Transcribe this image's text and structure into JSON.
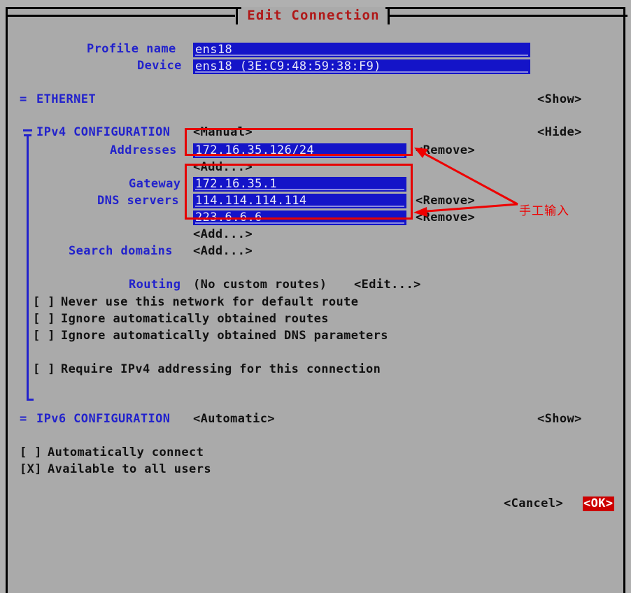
{
  "window": {
    "title": "Edit Connection"
  },
  "form": {
    "profile_name_label": "Profile name",
    "profile_name_value": "ens18",
    "device_label": "Device",
    "device_value": "ens18 (3E:C9:48:59:38:F9)"
  },
  "ethernet": {
    "marker": "=",
    "label": "ETHERNET",
    "toggle": "<Show>"
  },
  "ipv4": {
    "label": "IPv4 CONFIGURATION",
    "method": "<Manual>",
    "toggle": "<Hide>",
    "addresses_label": "Addresses",
    "addresses": [
      {
        "value": "172.16.35.126/24",
        "remove": "<Remove>"
      }
    ],
    "addresses_add": "<Add...>",
    "gateway_label": "Gateway",
    "gateway_value": "172.16.35.1",
    "dns_label": "DNS servers",
    "dns_servers": [
      {
        "value": "114.114.114.114",
        "remove": "<Remove>"
      },
      {
        "value": "223.6.6.6",
        "remove": "<Remove>"
      }
    ],
    "dns_add": "<Add...>",
    "search_domains_label": "Search domains",
    "search_domains_add": "<Add...>",
    "routing_label": "Routing",
    "routing_status": "(No custom routes)",
    "routing_edit": "<Edit...>",
    "checkboxes": [
      {
        "state": "[ ]",
        "label": "Never use this network for default route"
      },
      {
        "state": "[ ]",
        "label": "Ignore automatically obtained routes"
      },
      {
        "state": "[ ]",
        "label": "Ignore automatically obtained DNS parameters"
      },
      {
        "state": "[ ]",
        "label": "Require IPv4 addressing for this connection"
      }
    ]
  },
  "ipv6": {
    "marker": "=",
    "label": "IPv6 CONFIGURATION",
    "method": "<Automatic>",
    "toggle": "<Show>"
  },
  "connection_options": [
    {
      "state": "[ ]",
      "label": "Automatically connect"
    },
    {
      "state": "[X]",
      "label": "Available to all users"
    }
  ],
  "buttons": {
    "cancel": "<Cancel>",
    "ok": "<OK>"
  },
  "annotation": {
    "note": "手工输入",
    "color": "#ee0000"
  },
  "colors": {
    "background": "#aaaaaa",
    "field_blue": "#1414c8",
    "label_blue": "#2222cc",
    "title_red": "#b01818",
    "annotation_red": "#ee0000",
    "ok_highlight": "#cc0000"
  }
}
